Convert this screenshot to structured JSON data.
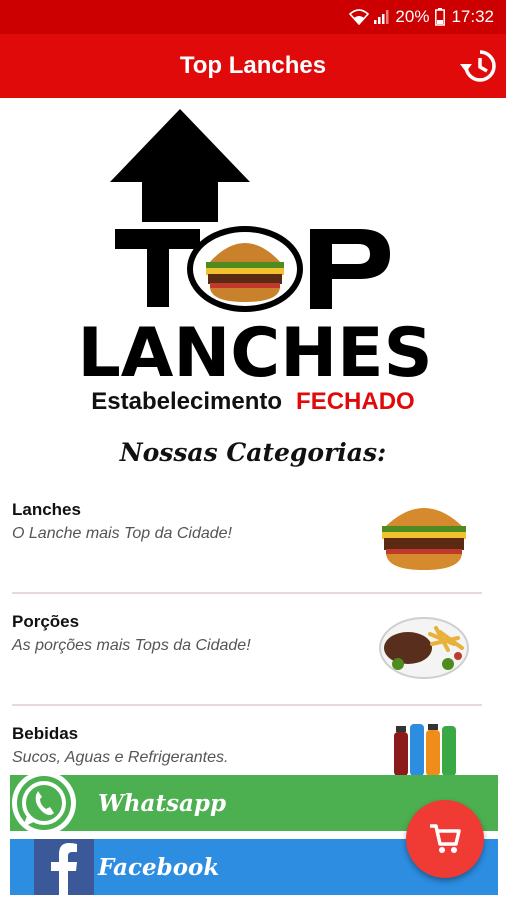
{
  "status_bar": {
    "battery": "20%",
    "time": "17:32"
  },
  "app_bar": {
    "title": "Top Lanches"
  },
  "logo": {
    "line1": "TOP",
    "line2": "LANCHES"
  },
  "store_status": {
    "label": "Estabelecimento",
    "state": "FECHADO"
  },
  "section_heading": "Nossas Categorias:",
  "categories": [
    {
      "name": "Lanches",
      "description": "O Lanche mais Top da Cidade!"
    },
    {
      "name": "Porções",
      "description": "As porções mais Tops da Cidade!"
    },
    {
      "name": "Bebidas",
      "description": "Sucos, Aguas e Refrigerantes."
    }
  ],
  "social": {
    "whatsapp": "Whatsapp",
    "facebook": "Facebook"
  },
  "colors": {
    "primary": "#e00a0a",
    "whatsapp": "#4caf50",
    "facebook": "#2d8de0",
    "fab": "#ef3b34"
  }
}
